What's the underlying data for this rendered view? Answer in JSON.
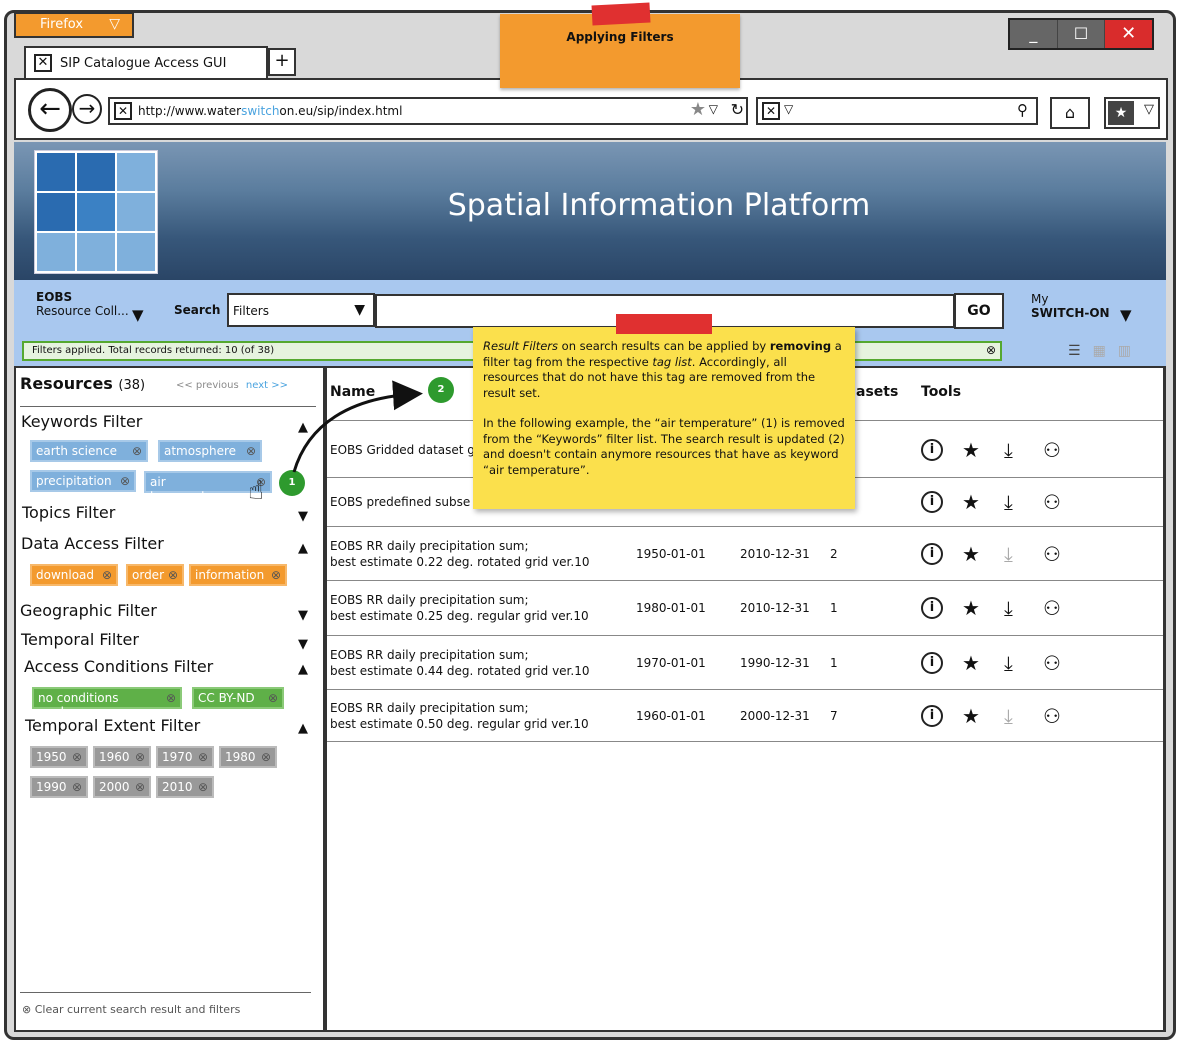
{
  "browser": {
    "brand": "Firefox",
    "tab_title": "SIP Catalogue Access GUI",
    "url_prefix": "http://www.water",
    "url_highlight": "switch",
    "url_suffix": "on.eu/sip/index.html",
    "win_min": "_",
    "win_max": "☐",
    "win_close": "✕"
  },
  "annotation_top": {
    "text": "Applying Filters"
  },
  "banner": {
    "title": "Spatial Information Platform"
  },
  "searchbar": {
    "collection_title": "EOBS",
    "collection_sub": "Resource Coll...",
    "search_label": "Search",
    "filter_value": "Filters",
    "go_label": "GO",
    "my_label": "My",
    "switch_label": "SWITCH-ON"
  },
  "status": {
    "text": "Filters applied. Total records returned: 10 (of 38)"
  },
  "sidebar": {
    "title": "Resources",
    "count": "(38)",
    "prev": "<< previous",
    "next": "next >>",
    "keywords": {
      "title": "Keywords Filter",
      "tags": [
        "earth science",
        "atmosphere",
        "precipitation",
        "air temperature"
      ]
    },
    "topics": {
      "title": "Topics Filter"
    },
    "data_access": {
      "title": "Data Access Filter",
      "tags": [
        "download",
        "order",
        "information"
      ]
    },
    "geographic": {
      "title": "Geographic Filter"
    },
    "temporal": {
      "title": "Temporal Filter"
    },
    "access_conditions": {
      "title": "Access Conditions Filter",
      "tags": [
        "no conditions apply",
        "CC BY-ND"
      ]
    },
    "temporal_extent": {
      "title": "Temporal Extent Filter",
      "tags": [
        "1950",
        "1960",
        "1970",
        "1980",
        "1990",
        "2000",
        "2010"
      ]
    },
    "clear": "Clear current search result and filters"
  },
  "table": {
    "col_name": "Name",
    "col_datasets": "asets",
    "col_tools": "Tools",
    "rows": [
      {
        "name1": "EOBS Gridded dataset g",
        "name2": "",
        "start": "",
        "end": "",
        "count": "",
        "download_enabled": true
      },
      {
        "name1": "EOBS predefined subse",
        "name2": "",
        "start": "",
        "end": "",
        "count": "",
        "download_enabled": true
      },
      {
        "name1": "EOBS RR daily precipitation sum;",
        "name2": "best estimate 0.22 deg. rotated grid ver.10",
        "start": "1950-01-01",
        "end": "2010-12-31",
        "count": "2",
        "download_enabled": false
      },
      {
        "name1": "EOBS RR daily precipitation sum;",
        "name2": "best estimate 0.25 deg. regular grid ver.10",
        "start": "1980-01-01",
        "end": "2010-12-31",
        "count": "1",
        "download_enabled": true
      },
      {
        "name1": "EOBS RR daily precipitation sum;",
        "name2": "best estimate 0.44 deg. rotated grid ver.10",
        "start": "1970-01-01",
        "end": "1990-12-31",
        "count": "1",
        "download_enabled": true
      },
      {
        "name1": "EOBS RR daily precipitation sum;",
        "name2": "best estimate 0.50 deg. regular grid ver.10",
        "start": "1960-01-01",
        "end": "2000-12-31",
        "count": "7",
        "download_enabled": false
      }
    ]
  },
  "note": {
    "p1_a": "Result Filters",
    "p1_b": " on search results can be applied by ",
    "p1_c": "removing",
    "p1_d": " a filter tag from the respective ",
    "p1_e": "tag list",
    "p1_f": ". Accordingly, all resources that do not have this tag are removed from the result set.",
    "p2": "In the following example, the “air temperature” (1) is removed from the “Keywords” filter list. The search result is updated (2) and doesn't contain anymore resources that have as keyword “air temperature”."
  },
  "badges": {
    "one": "1",
    "two": "2"
  },
  "icons": {
    "info": "info-icon",
    "star": "star-icon",
    "download": "download-icon",
    "share": "share-icon",
    "tag_remove": "remove-circle-icon"
  },
  "colors": {
    "tag_blue": "#7fb0dc",
    "tag_orange": "#f39a2e",
    "tag_green": "#5fb048",
    "tag_gray": "#999999",
    "searchbar_bg": "#a9c8ef",
    "note_yellow": "#fbe04c",
    "note_orange": "#f39a2e",
    "badge_green": "#2e9a2e"
  }
}
